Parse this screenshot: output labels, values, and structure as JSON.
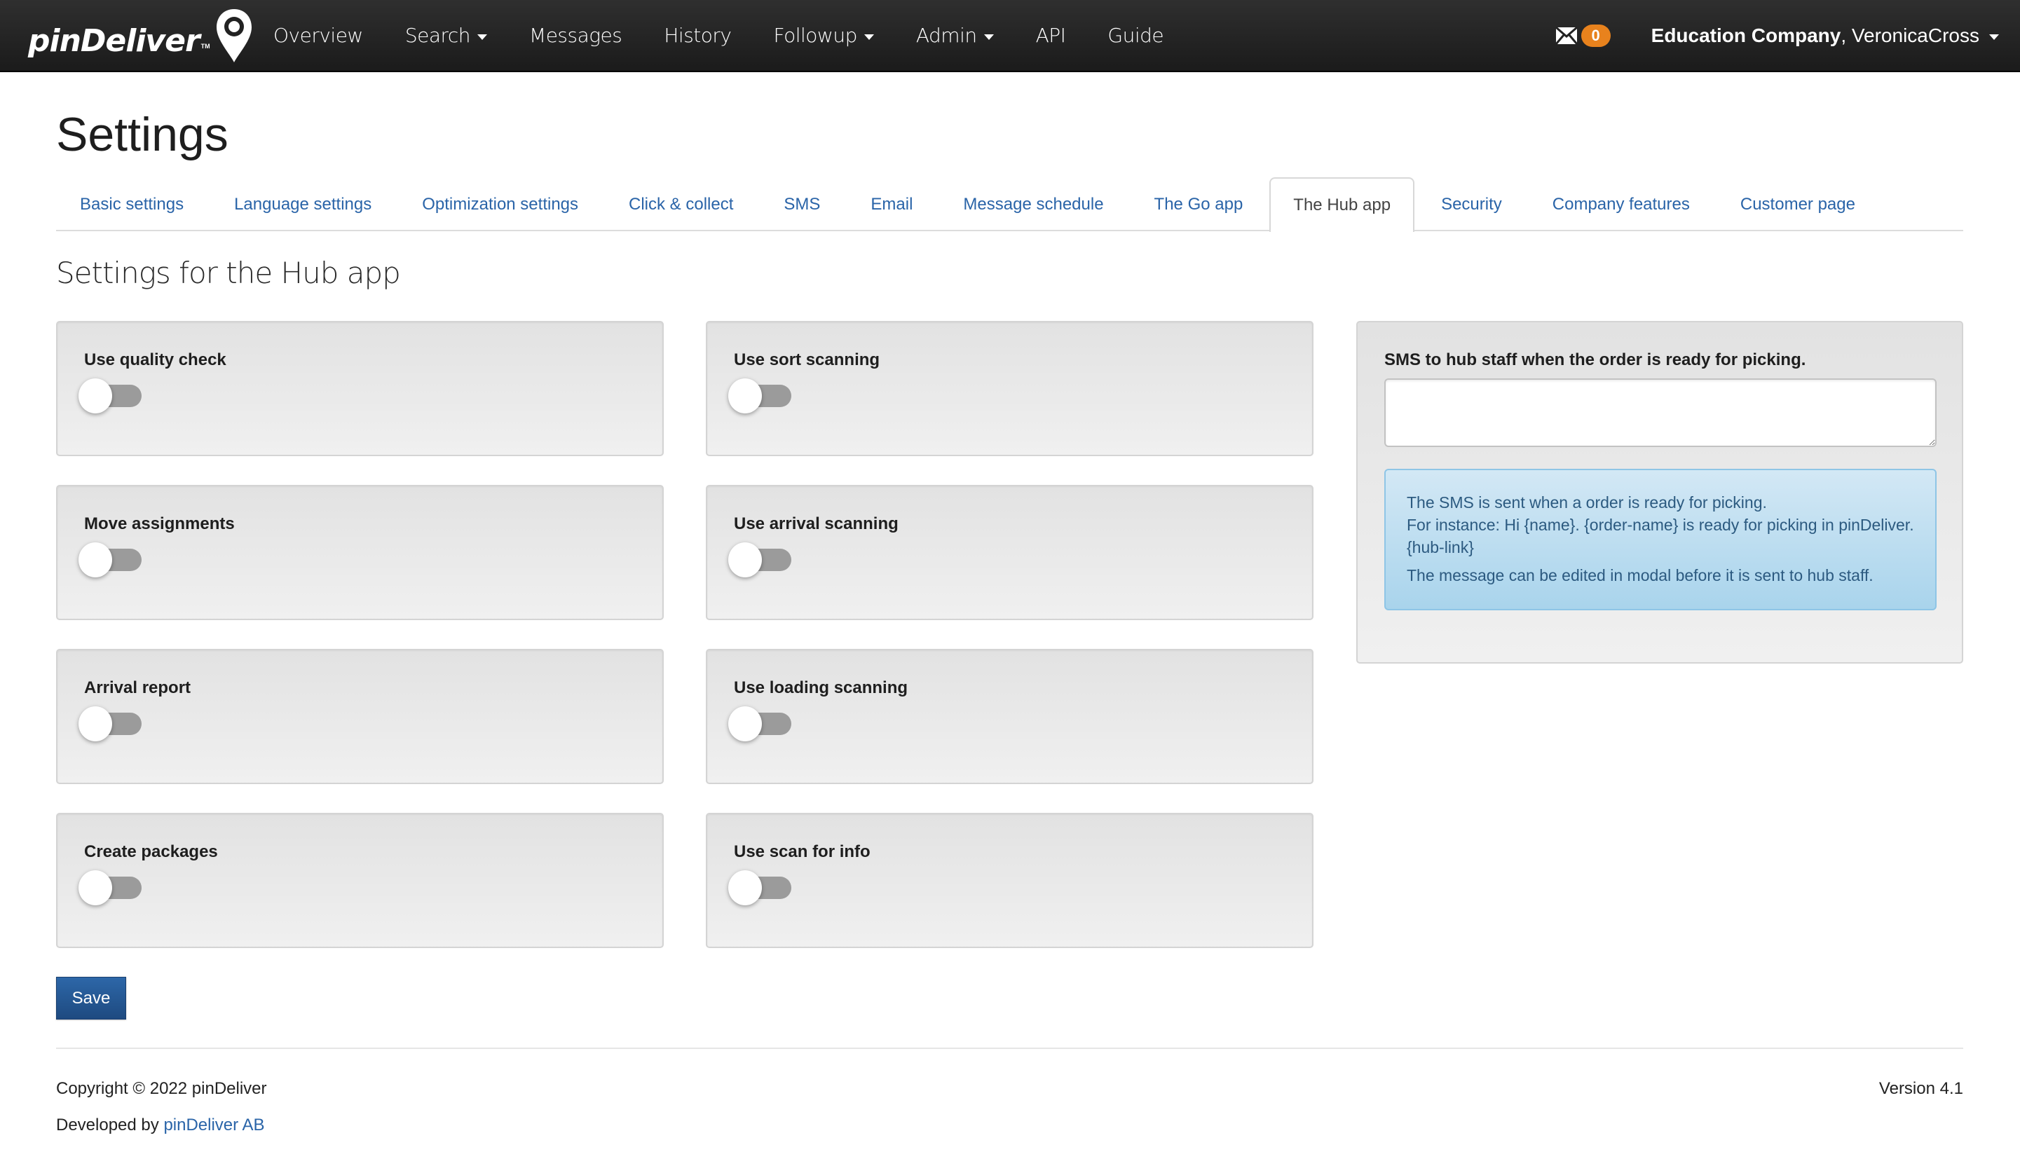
{
  "navbar": {
    "brand": "pinDeliver",
    "brand_tm": "TM",
    "items": [
      {
        "label": "Overview",
        "dropdown": false
      },
      {
        "label": "Search",
        "dropdown": true
      },
      {
        "label": "Messages",
        "dropdown": false
      },
      {
        "label": "History",
        "dropdown": false
      },
      {
        "label": "Followup",
        "dropdown": true
      },
      {
        "label": "Admin",
        "dropdown": true
      },
      {
        "label": "API",
        "dropdown": false
      },
      {
        "label": "Guide",
        "dropdown": false
      }
    ],
    "message_count": "0",
    "company": "Education Company",
    "separator": ", ",
    "username": "VeronicaCross",
    "badge_color": "#e8821d"
  },
  "page": {
    "title": "Settings",
    "subtitle": "Settings for the Hub app"
  },
  "tabs": [
    {
      "label": "Basic settings",
      "active": false
    },
    {
      "label": "Language settings",
      "active": false
    },
    {
      "label": "Optimization settings",
      "active": false
    },
    {
      "label": "Click & collect",
      "active": false
    },
    {
      "label": "SMS",
      "active": false
    },
    {
      "label": "Email",
      "active": false
    },
    {
      "label": "Message schedule",
      "active": false
    },
    {
      "label": "The Go app",
      "active": false
    },
    {
      "label": "The Hub app",
      "active": true
    },
    {
      "label": "Security",
      "active": false
    },
    {
      "label": "Company features",
      "active": false
    },
    {
      "label": "Customer page",
      "active": false
    }
  ],
  "toggles": [
    {
      "label": "Use quality check",
      "checked": false
    },
    {
      "label": "Use sort scanning",
      "checked": false
    },
    {
      "label": "Move assignments",
      "checked": false
    },
    {
      "label": "Use arrival scanning",
      "checked": false
    },
    {
      "label": "Arrival report",
      "checked": false
    },
    {
      "label": "Use loading scanning",
      "checked": false
    },
    {
      "label": "Create packages",
      "checked": false
    },
    {
      "label": "Use scan for info",
      "checked": false
    }
  ],
  "sms_panel": {
    "label": "SMS to hub staff when the order is ready for picking.",
    "value": "",
    "info_line1": "The SMS is sent when a order is ready for picking.",
    "info_line2": "For instance: Hi {name}. {order-name} is ready for picking in pinDeliver. {hub-link}",
    "info_line3": "The message can be edited in modal before it is sent to hub staff."
  },
  "actions": {
    "save_label": "Save"
  },
  "footer": {
    "copyright": "Copyright © 2022 pinDeliver",
    "developed_prefix": "Developed by ",
    "developed_link": "pinDeliver AB",
    "version": "Version 4.1"
  }
}
